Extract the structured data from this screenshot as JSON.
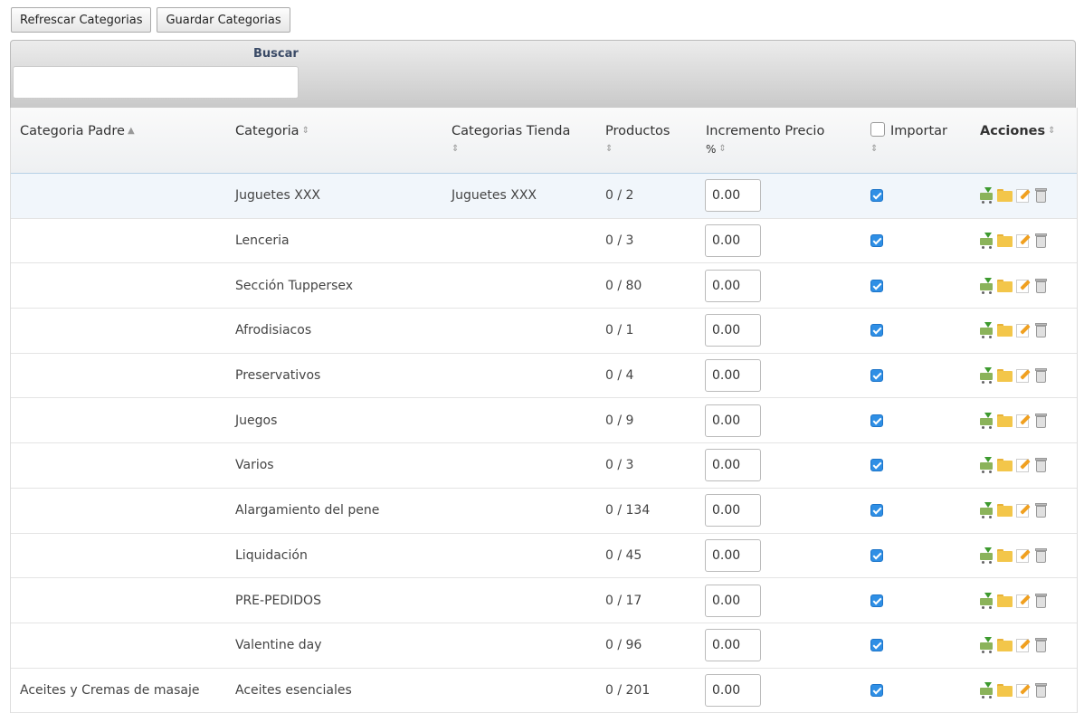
{
  "toolbar": {
    "refresh_label": "Refrescar Categorias",
    "save_label": "Guardar Categorias"
  },
  "filter": {
    "search_label": "Buscar",
    "search_value": ""
  },
  "columns": {
    "parent": "Categoria Padre",
    "category": "Categoria",
    "store": "Categorias Tienda",
    "products": "Productos",
    "increase": "Incremento Precio",
    "increase_suffix": "%",
    "import": "Importar",
    "actions": "Acciones"
  },
  "rows": [
    {
      "parent": "",
      "category": "Juguetes XXX",
      "store": "Juguetes XXX",
      "products": "0 / 2",
      "increase": "0.00",
      "import": true
    },
    {
      "parent": "",
      "category": "Lenceria",
      "store": "",
      "products": "0 / 3",
      "increase": "0.00",
      "import": true
    },
    {
      "parent": "",
      "category": "Sección Tuppersex",
      "store": "",
      "products": "0 / 80",
      "increase": "0.00",
      "import": true
    },
    {
      "parent": "",
      "category": "Afrodisiacos",
      "store": "",
      "products": "0 / 1",
      "increase": "0.00",
      "import": true
    },
    {
      "parent": "",
      "category": "Preservativos",
      "store": "",
      "products": "0 / 4",
      "increase": "0.00",
      "import": true
    },
    {
      "parent": "",
      "category": "Juegos",
      "store": "",
      "products": "0 / 9",
      "increase": "0.00",
      "import": true
    },
    {
      "parent": "",
      "category": "Varios",
      "store": "",
      "products": "0 / 3",
      "increase": "0.00",
      "import": true
    },
    {
      "parent": "",
      "category": "Alargamiento del pene",
      "store": "",
      "products": "0 / 134",
      "increase": "0.00",
      "import": true
    },
    {
      "parent": "",
      "category": "Liquidación",
      "store": "",
      "products": "0 / 45",
      "increase": "0.00",
      "import": true
    },
    {
      "parent": "",
      "category": "PRE-PEDIDOS",
      "store": "",
      "products": "0 / 17",
      "increase": "0.00",
      "import": true
    },
    {
      "parent": "",
      "category": "Valentine day",
      "store": "",
      "products": "0 / 96",
      "increase": "0.00",
      "import": true
    },
    {
      "parent": "Aceites y Cremas de masaje",
      "category": "Aceites esenciales",
      "store": "",
      "products": "0 / 201",
      "increase": "0.00",
      "import": true
    }
  ]
}
